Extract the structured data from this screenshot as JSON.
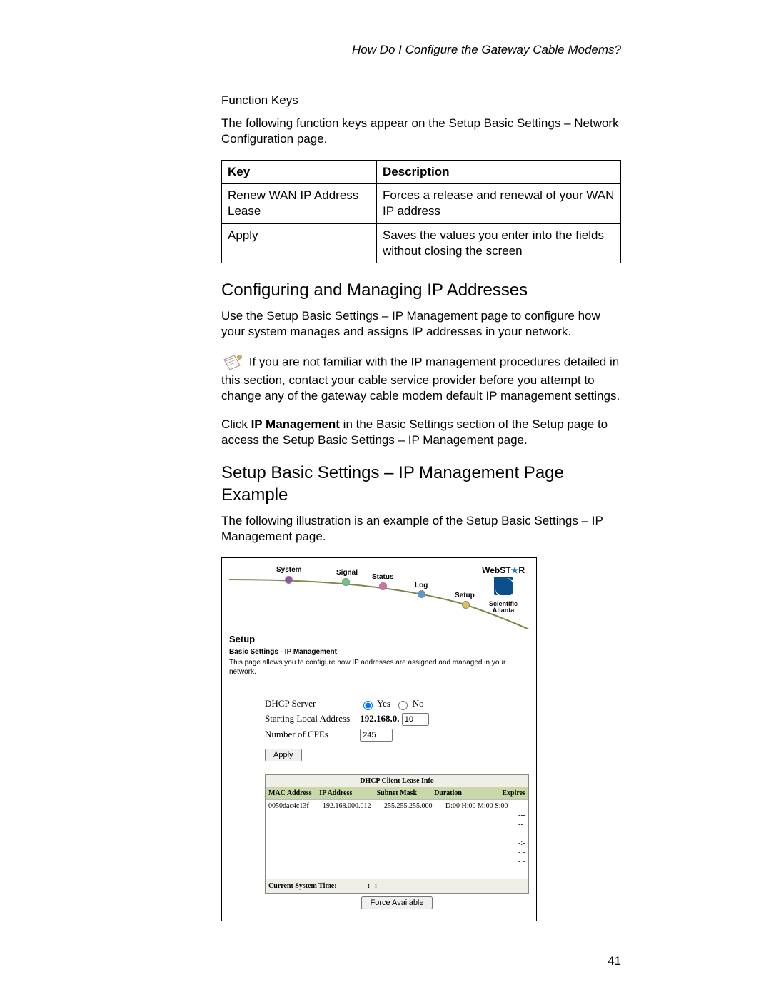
{
  "header": {
    "question": "How Do I Configure the Gateway Cable Modems?"
  },
  "section1": {
    "title": "Function Keys",
    "intro": "The following function keys appear on the Setup Basic Settings – Network Configuration page.",
    "table": {
      "head_key": "Key",
      "head_desc": "Description",
      "rows": [
        {
          "key": "Renew WAN IP Address Lease",
          "desc": "Forces a release and renewal of your WAN IP address"
        },
        {
          "key": "Apply",
          "desc": "Saves the values you enter into the fields without closing the screen"
        }
      ]
    }
  },
  "section2": {
    "title": "Configuring and Managing IP Addresses",
    "p1": "Use the Setup Basic Settings – IP Management page to configure how your system manages and assigns IP addresses in your network.",
    "note": "If you are not familiar with the IP management procedures detailed in this section, contact your cable service provider before you attempt to change any of the gateway cable modem default IP management settings.",
    "p2a": "Click ",
    "p2b": "IP Management",
    "p2c": " in the Basic Settings section of the Setup page to access the Setup Basic Settings – IP Management page."
  },
  "section3": {
    "title": "Setup Basic Settings – IP Management Page Example",
    "p1": "The following illustration is an example of the Setup Basic Settings – IP Management page."
  },
  "screenshot": {
    "nav": {
      "system": "System",
      "signal": "Signal",
      "status": "Status",
      "log": "Log",
      "setup": "Setup"
    },
    "brand": {
      "webstar": "WebST★R",
      "company1": "Scientific",
      "company2": "Atlanta"
    },
    "setup_head": "Setup",
    "setup_sub": "Basic Settings - IP Management",
    "setup_desc": "This page allows you to configure how IP addresses are assigned and managed in your network.",
    "form": {
      "dhcp_label": "DHCP Server",
      "yes": "Yes",
      "no": "No",
      "start_label": "Starting Local Address",
      "start_prefix": "192.168.0.",
      "start_value": "10",
      "cpe_label": "Number of CPEs",
      "cpe_value": "245",
      "apply": "Apply"
    },
    "lease": {
      "title": "DHCP Client Lease Info",
      "h_mac": "MAC Address",
      "h_ip": "IP Address",
      "h_sub": "Subnet Mask",
      "h_dur": "Duration",
      "h_exp": "Expires",
      "row": {
        "mac": "0050dac4c13f",
        "ip": "192.168.000.012",
        "sub": "255.255.255.000",
        "dur": "D:00 H:00 M:00 S:00",
        "exp": "--- --- -- --:--:-- ----"
      },
      "systime": "Current System Time: --- --- -- --:--:-- ----",
      "force": "Force Available"
    }
  },
  "page_number": "41"
}
